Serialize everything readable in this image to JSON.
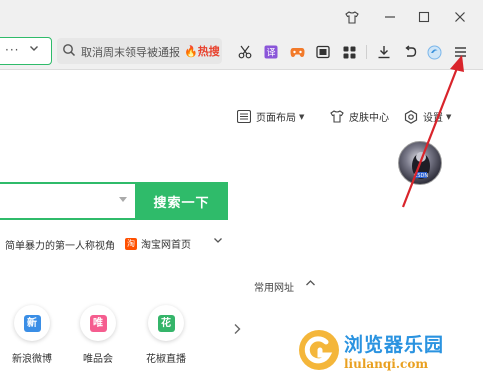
{
  "address": {
    "value": "···"
  },
  "search": {
    "text": "取消周末领导被通报",
    "hot": "🔥热搜"
  },
  "page": {
    "links": {
      "layout": "页面布局",
      "skin": "皮肤中心",
      "settings": "设置"
    },
    "search_button": "搜索一下",
    "hot_line": "简单暴力的第一人称视角",
    "taobao": "淘宝网首页",
    "taobao_icon": "淘",
    "common_label": "常用网址",
    "sites": [
      {
        "name": "新浪微博",
        "badge": "新",
        "color": "#3a8ee6"
      },
      {
        "name": "唯品会",
        "badge": "唯",
        "color": "#f55d8f"
      },
      {
        "name": "花椒直播",
        "badge": "花",
        "color": "#35b56a"
      }
    ]
  },
  "watermark": {
    "title": "浏览器乐园",
    "url": "liulanqi.com"
  },
  "colors": {
    "accent": "#2fbb6a",
    "annotation_arrow": "#d9242b"
  }
}
